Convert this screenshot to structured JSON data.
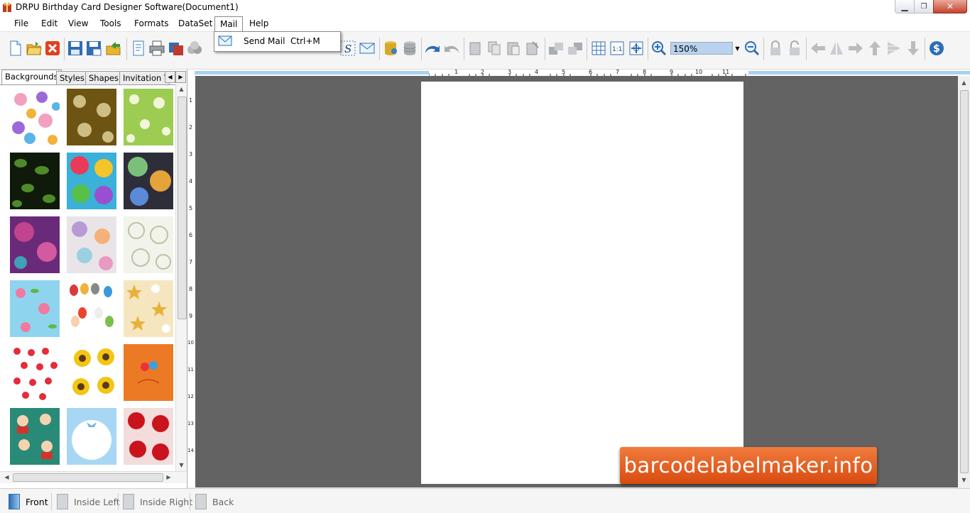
{
  "window": {
    "title": "DRPU Birthday Card Designer Software(Document1)"
  },
  "menubar": {
    "items": [
      "File",
      "Edit",
      "View",
      "Tools",
      "Formats",
      "DataSet",
      "Mail",
      "Help"
    ]
  },
  "mail_menu": {
    "item_label": "Send Mail",
    "shortcut": "Ctrl+M"
  },
  "toolbar": {
    "zoom_value": "150%"
  },
  "left_panel": {
    "tabs": [
      "Backgrounds",
      "Styles",
      "Shapes",
      "Invitation Te"
    ],
    "active_tab": "Backgrounds"
  },
  "rulers": {
    "top_labels": [
      "1",
      "2",
      "3",
      "4",
      "5",
      "6",
      "7",
      "8",
      "9",
      "10",
      "11"
    ],
    "left_labels": [
      "1",
      "2",
      "3",
      "4",
      "5",
      "6",
      "7",
      "8",
      "9",
      "10",
      "11",
      "12",
      "13",
      "14"
    ]
  },
  "watermark": {
    "text": "barcodelabelmaker.info"
  },
  "page_tabs": [
    "Front",
    "Inside Left",
    "Inside Right",
    "Back"
  ],
  "colors": {
    "canvas": "#636363",
    "accent": "#2a6fc0",
    "watermark": "#e2631f"
  }
}
